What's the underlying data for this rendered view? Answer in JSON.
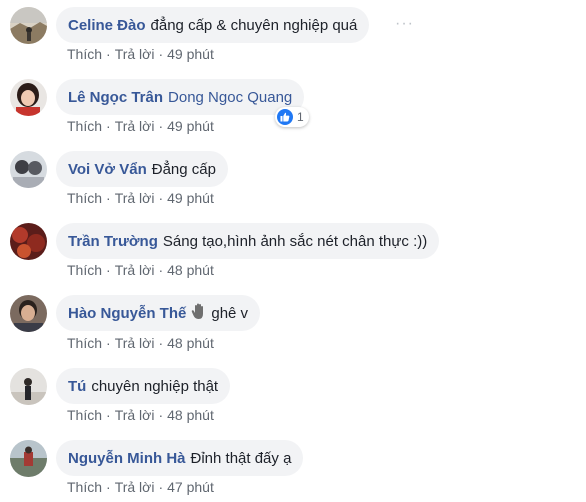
{
  "comments": [
    {
      "author": "Celine Đào",
      "text": "đẳng cấp & chuyên nghiệp quá",
      "like": "Thích",
      "reply": "Trả lời",
      "time": "49 phút",
      "more": "···"
    },
    {
      "author": "Lê Ngọc Trân",
      "mention": "Dong Ngoc Quang",
      "like": "Thích",
      "reply": "Trả lời",
      "time": "49 phút",
      "reaction_count": "1"
    },
    {
      "author": "Voi Vở Vẩn",
      "text": "Đẳng cấp",
      "like": "Thích",
      "reply": "Trả lời",
      "time": "49 phút"
    },
    {
      "author": "Trần Trường",
      "text": "Sáng tạo,hình ảnh sắc nét chân thực :))",
      "like": "Thích",
      "reply": "Trả lời",
      "time": "48 phút"
    },
    {
      "author": "Hào Nguyễn Thế",
      "text": "ghê v",
      "like": "Thích",
      "reply": "Trả lời",
      "time": "48 phút"
    },
    {
      "author": "Tú",
      "text": "chuyên nghiệp thật",
      "like": "Thích",
      "reply": "Trả lời",
      "time": "48 phút"
    },
    {
      "author": "Nguyễn Minh Hà",
      "text": "Đỉnh thật đấy ạ",
      "like": "Thích",
      "reply": "Trả lời",
      "time": "47 phút"
    }
  ],
  "icons": {
    "like_reaction": "thumbs-up-icon",
    "wave_emoji": "waving-hand-icon",
    "more_options": "more-options-icon"
  },
  "colors": {
    "author": "#385898",
    "text": "#1d2129",
    "meta": "#606770",
    "bubble": "#f2f3f5",
    "like_blue": "#2078f4"
  }
}
